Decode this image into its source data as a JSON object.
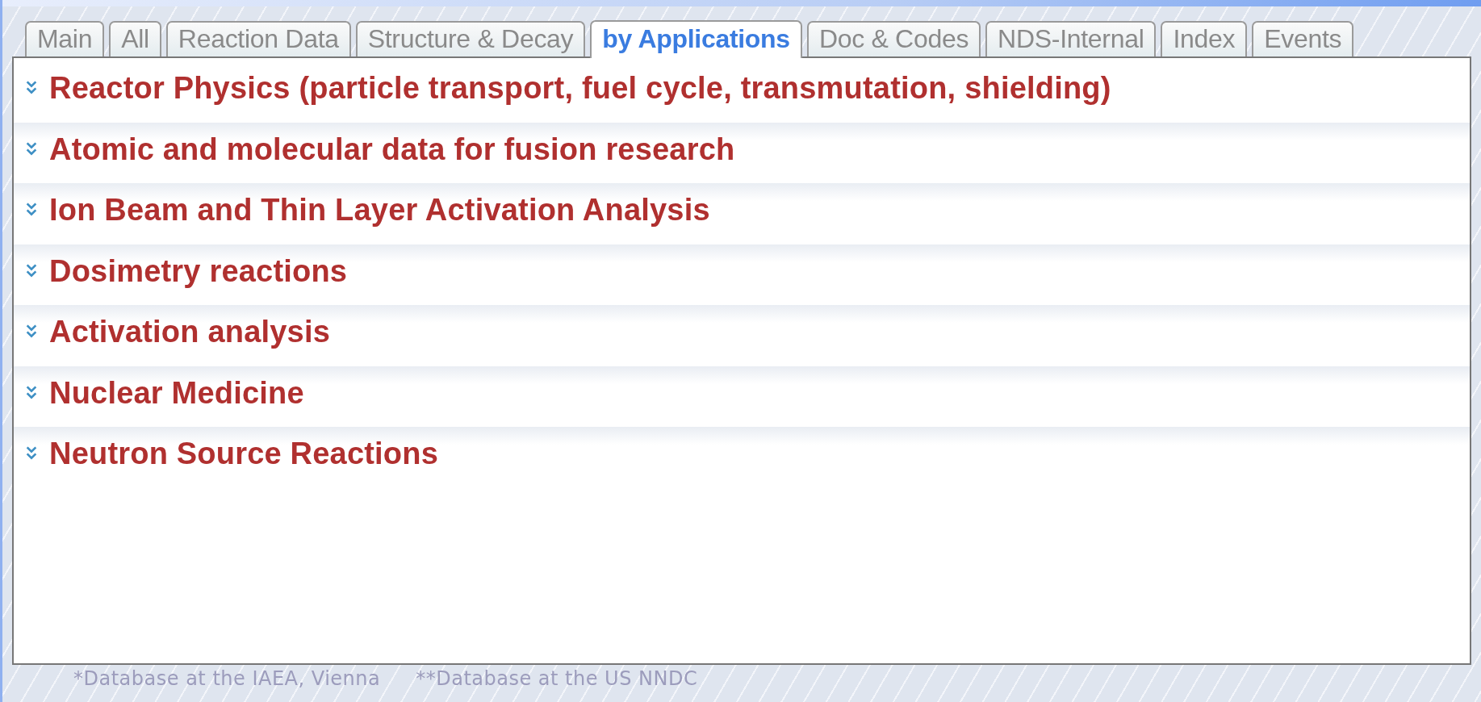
{
  "tabs": [
    {
      "label": "Main",
      "selected": false
    },
    {
      "label": "All",
      "selected": false
    },
    {
      "label": "Reaction Data",
      "selected": false
    },
    {
      "label": "Structure & Decay",
      "selected": false
    },
    {
      "label": "by Applications",
      "selected": true
    },
    {
      "label": "Doc & Codes",
      "selected": false
    },
    {
      "label": "NDS-Internal",
      "selected": false
    },
    {
      "label": "Index",
      "selected": false
    },
    {
      "label": "Events",
      "selected": false
    }
  ],
  "sections": [
    {
      "title": "Reactor Physics (particle transport, fuel cycle, transmutation, shielding)"
    },
    {
      "title": "Atomic and molecular data for fusion research"
    },
    {
      "title": "Ion Beam and Thin Layer Activation Analysis"
    },
    {
      "title": "Dosimetry reactions"
    },
    {
      "title": "Activation analysis"
    },
    {
      "title": "Nuclear Medicine"
    },
    {
      "title": "Neutron Source Reactions"
    }
  ],
  "footnotes": [
    "*Database at the IAEA, Vienna",
    "**Database at the US NNDC"
  ]
}
